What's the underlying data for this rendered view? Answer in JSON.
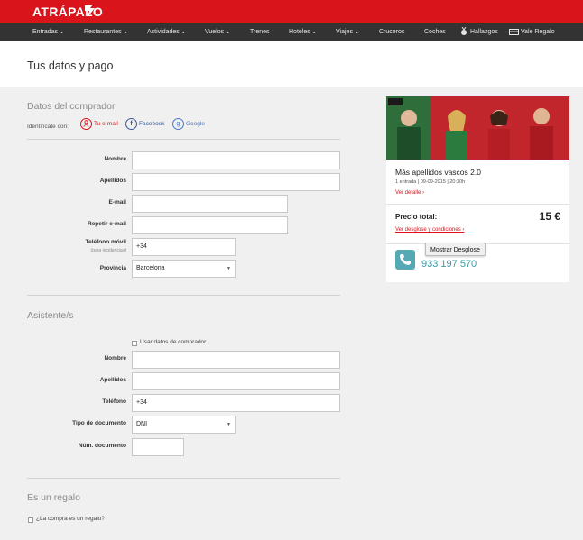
{
  "header": {
    "logo": "ATRÁPALO"
  },
  "nav": {
    "items": [
      {
        "label": "Entradas",
        "chevron": true
      },
      {
        "label": "Restaurantes",
        "chevron": true
      },
      {
        "label": "Actividades",
        "chevron": true
      },
      {
        "label": "Vuelos",
        "chevron": true
      },
      {
        "label": "Trenes",
        "chevron": false
      },
      {
        "label": "Hoteles",
        "chevron": true
      },
      {
        "label": "Viajes",
        "chevron": true
      },
      {
        "label": "Cruceros",
        "chevron": false
      },
      {
        "label": "Coches",
        "chevron": false
      },
      {
        "label": "Hallazgos",
        "chevron": false,
        "icon": "medal-icon"
      },
      {
        "label": "Vale Regalo",
        "chevron": false,
        "icon": "gift-card-icon"
      }
    ]
  },
  "page": {
    "title": "Tus datos y pago"
  },
  "buyer": {
    "section_title": "Datos del comprador",
    "identify_label": "Identifícate con:",
    "identify_options": [
      {
        "label": "Tu e-mail",
        "icon": "user-icon",
        "color": "#d9141b"
      },
      {
        "label": "Facebook",
        "icon": "facebook-icon",
        "color": "#3b5998"
      },
      {
        "label": "Google",
        "icon": "google-icon",
        "color": "#4a78c2"
      }
    ],
    "fields": {
      "nombre": {
        "label": "Nombre",
        "value": ""
      },
      "apellidos": {
        "label": "Apellidos",
        "value": ""
      },
      "email": {
        "label": "E-mail",
        "value": ""
      },
      "repeat_email": {
        "label": "Repetir e-mail",
        "value": ""
      },
      "phone": {
        "label": "Teléfono móvil",
        "sublabel": "(para incidencias)",
        "value": "+34"
      },
      "province": {
        "label": "Provincia",
        "value": "Barcelona"
      }
    }
  },
  "attendees": {
    "section_title": "Asistente/s",
    "use_buyer_label": "Usar datos de comprador",
    "fields": {
      "nombre": {
        "label": "Nombre",
        "value": ""
      },
      "apellidos": {
        "label": "Apellidos",
        "value": ""
      },
      "phone": {
        "label": "Teléfono",
        "value": "+34"
      },
      "doc_type": {
        "label": "Tipo de documento",
        "value": "DNI"
      },
      "doc_number": {
        "label": "Núm. documento",
        "value": ""
      }
    }
  },
  "gift": {
    "section_title": "Es un regalo",
    "checkbox_label": "¿La compra es un regalo?"
  },
  "summary": {
    "event_title": "Más apellidos vascos 2.0",
    "event_details": "1 entrada | 09-09-2015 | 20:30h",
    "details_link": "Ver detalle",
    "price_label": "Precio total:",
    "price_value": "15 €",
    "conditions_link": "Ver desglose y condiciones",
    "tooltip": "Mostrar Desglose",
    "phone_number": "933 197 570"
  },
  "colors": {
    "brand_red": "#d9141b",
    "nav_bg": "#333333",
    "phone_teal": "#3a9aa7"
  }
}
